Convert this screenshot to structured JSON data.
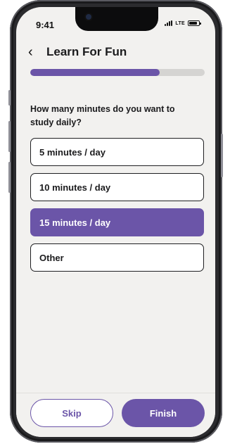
{
  "status": {
    "time": "9:41",
    "network": "LTE"
  },
  "header": {
    "title": "Learn For Fun"
  },
  "progress": {
    "fraction": 0.74
  },
  "question": "How many minutes do you want to study daily?",
  "options": [
    {
      "label": "5 minutes / day",
      "selected": false
    },
    {
      "label": "10 minutes / day",
      "selected": false
    },
    {
      "label": "15 minutes / day",
      "selected": true
    },
    {
      "label": "Other",
      "selected": false
    }
  ],
  "footer": {
    "skip_label": "Skip",
    "finish_label": "Finish"
  },
  "colors": {
    "accent": "#6b55a8",
    "background": "#f2f1ef"
  }
}
